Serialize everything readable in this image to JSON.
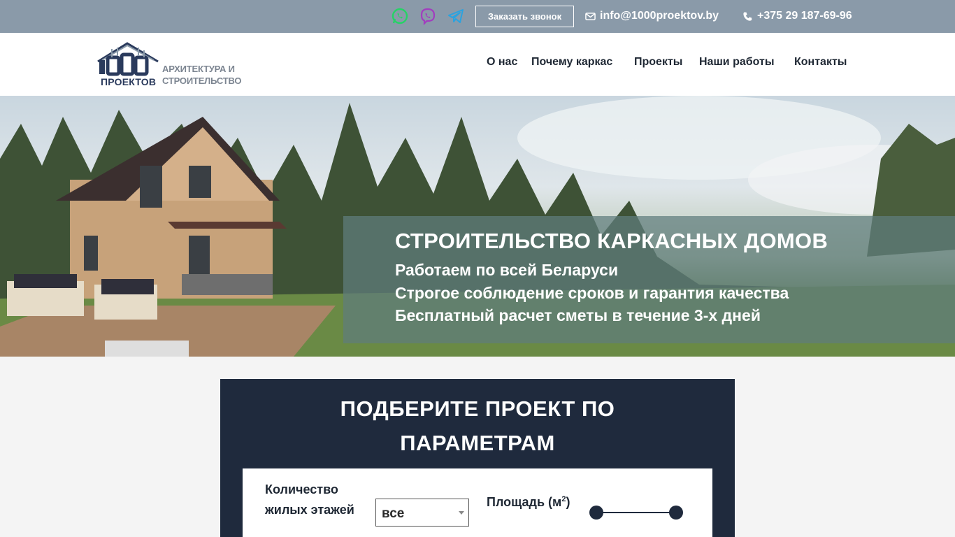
{
  "topbar": {
    "socials": [
      {
        "name": "whatsapp",
        "icon": "whatsapp-icon",
        "color": "#25d366"
      },
      {
        "name": "viber",
        "icon": "viber-icon",
        "color": "#a23dbf"
      },
      {
        "name": "telegram",
        "icon": "telegram-icon",
        "color": "#2aa3e0"
      }
    ],
    "callback_label": "Заказать звонок",
    "email": "info@1000proektov.by",
    "phone": "+375 29 187-69-96"
  },
  "header": {
    "logo": {
      "mark_text": "1000",
      "sub": "ПРОЕКТОВ",
      "tagline_1": "АРХИТЕКТУРА И",
      "tagline_2": "СТРОИТЕЛЬСТВО"
    },
    "nav": [
      "О нас",
      "Почему каркас",
      "Проекты",
      "Наши работы",
      "Контакты"
    ]
  },
  "hero": {
    "title": "СТРОИТЕЛЬСТВО КАРКАСНЫХ ДОМОВ",
    "lines": [
      "Работаем по всей Беларуси",
      "Строгое соблюдение сроков и гарантия качества",
      "Бесплатный расчет сметы в течение 3-х дней"
    ]
  },
  "filter": {
    "title_line_1": "ПОДБЕРИТЕ ПРОЕКТ ПО",
    "title_line_2": "ПАРАМЕТРАМ",
    "floors_label": "Количество жилых этажей",
    "floors_value": "все",
    "area_label": "Площадь (м",
    "area_unit_sup": "2",
    "area_label_end": ")"
  },
  "colors": {
    "topbar": "#8a9aa9",
    "panel": "#1f2a3d",
    "brand_navy": "#2a3a5c"
  }
}
